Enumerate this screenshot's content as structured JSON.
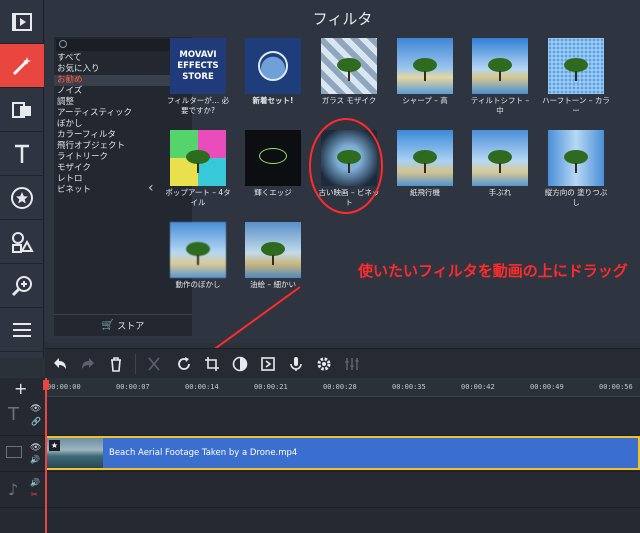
{
  "panel": {
    "title": "フィルタ"
  },
  "categories": {
    "items": [
      "すべて",
      "お気に入り",
      "お勧め",
      "ノイズ",
      "調整",
      "アーティスティック",
      "ぼかし",
      "カラーフィルタ",
      "飛行オブジェクト",
      "ライトリーク",
      "モザイク",
      "レトロ",
      "ビネット"
    ],
    "selected": "お勧め"
  },
  "store": {
    "label": "ストア"
  },
  "filters": [
    {
      "label": "フィルターが… 必要ですか?",
      "caption": "MOVAVI EFFECTS STORE"
    },
    {
      "label": "新着セット!",
      "bold": true
    },
    {
      "label": "ガラス モザイク"
    },
    {
      "label": "シャープ – 高"
    },
    {
      "label": "ティルトシフト – 中"
    },
    {
      "label": "ハーフトーン – カラー"
    },
    {
      "label": "ポップアート – 4タイル"
    },
    {
      "label": "輝くエッジ"
    },
    {
      "label": "古い映画 – ビネット"
    },
    {
      "label": "紙飛行機"
    },
    {
      "label": "手ぶれ"
    },
    {
      "label": "縦方向の 塗りつぶし"
    },
    {
      "label": "動作のぼかし"
    },
    {
      "label": "油絵 – 細かい"
    }
  ],
  "callout": "使いたいフィルタを動画の上にドラッグ",
  "timeline": {
    "ticks": [
      "00:00:00",
      "00:00:07",
      "00:00:14",
      "00:00:21",
      "00:00:28",
      "00:00:35",
      "00:00:42",
      "00:00:49",
      "00:00:56"
    ],
    "clip_name": "Beach Aerial Footage Taken by a Drone.mp4"
  },
  "colors": {
    "accent": "#e8463e",
    "clip": "#3a6fd0",
    "callout": "#ff2b2b",
    "selection": "#f0c030"
  },
  "icons": {
    "rail": [
      "film-icon",
      "magic-wand-icon",
      "transitions-icon",
      "text-icon",
      "star-sticker-icon",
      "shapes-icon",
      "zoom-icon",
      "menu-icon"
    ],
    "toolbar": [
      "undo-icon",
      "redo-icon",
      "trash-icon",
      "cut-icon",
      "rotate-icon",
      "crop-icon",
      "color-adjust-icon",
      "stabilize-icon",
      "microphone-icon",
      "settings-icon",
      "equalizer-icon"
    ]
  }
}
